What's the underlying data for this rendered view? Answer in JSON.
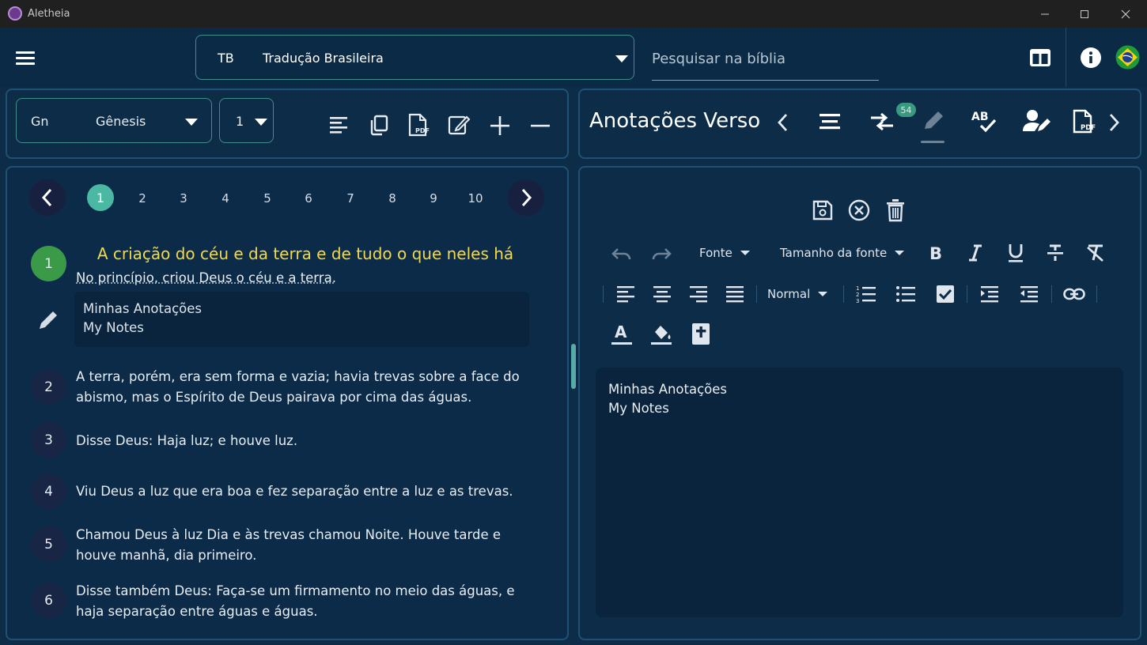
{
  "window": {
    "title": "Aletheia"
  },
  "header": {
    "version": {
      "abbr": "TB",
      "name": "Tradução Brasileira"
    },
    "search_placeholder": "Pesquisar na bíblia"
  },
  "left_toolbar": {
    "book": {
      "abbr": "Gn",
      "name": "Gênesis"
    },
    "chapter": "1"
  },
  "right_toolbar": {
    "title": "Anotações Verso",
    "badge_count": "54"
  },
  "chapters": [
    "1",
    "2",
    "3",
    "4",
    "5",
    "6",
    "7",
    "8",
    "9",
    "10"
  ],
  "active_chapter": "1",
  "passage": {
    "heading": "A criação do céu e da terra e de tudo o que neles há",
    "verses": [
      {
        "num": "1",
        "text": "No princípio, criou Deus o céu e a terra."
      },
      {
        "num": "2",
        "text": "A terra, porém, era sem forma e vazia; havia trevas sobre a face do abismo, mas o Espírito de Deus pairava por cima das águas."
      },
      {
        "num": "3",
        "text": "Disse Deus: Haja luz; e houve luz."
      },
      {
        "num": "4",
        "text": "Viu Deus a luz que era boa e fez separação entre a luz e as trevas."
      },
      {
        "num": "5",
        "text": "Chamou Deus à luz Dia e às trevas chamou Noite. Houve tarde e houve manhã, dia primeiro."
      },
      {
        "num": "6",
        "text": "Disse também Deus: Faça-se um firmamento no meio das águas, e haja separação entre águas e águas."
      }
    ],
    "note": {
      "line1": "Minhas Anotações",
      "line2": "My Notes"
    }
  },
  "editor": {
    "font_label": "Fonte",
    "font_size_label": "Tamanho da fonte",
    "style_label": "Normal",
    "content_line1": "Minhas Anotações",
    "content_line2": "My Notes"
  },
  "colors": {
    "background": "#0d2c48",
    "accent_teal": "#4ab8a3",
    "heading_yellow": "#f2d94a",
    "verse_circle": "#182545",
    "active_verse": "#3a9a48"
  }
}
